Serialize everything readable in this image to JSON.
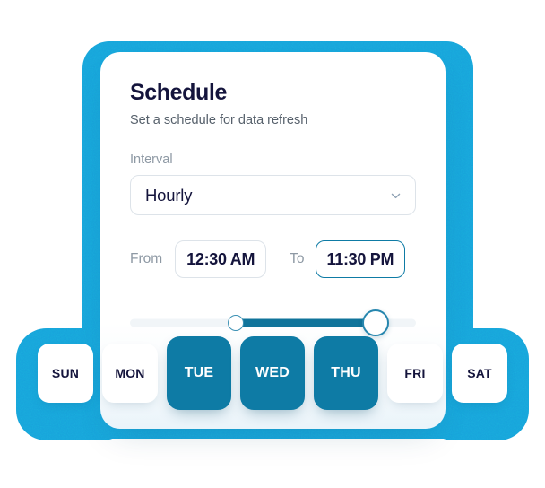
{
  "card": {
    "title": "Schedule",
    "subtitle": "Set a schedule for data refresh"
  },
  "interval": {
    "label": "Interval",
    "value": "Hourly",
    "chevron_icon": "chevron-down-icon"
  },
  "time_range": {
    "from_label": "From",
    "from_value": "12:30 AM",
    "to_label": "To",
    "to_value": "11:30 PM"
  },
  "slider": {
    "low_percent": 37,
    "high_percent": 86
  },
  "days": [
    {
      "label": "SUN",
      "selected": false
    },
    {
      "label": "MON",
      "selected": false
    },
    {
      "label": "TUE",
      "selected": true
    },
    {
      "label": "WED",
      "selected": true
    },
    {
      "label": "THU",
      "selected": true
    },
    {
      "label": "FRI",
      "selected": false
    },
    {
      "label": "SAT",
      "selected": false
    }
  ],
  "colors": {
    "accent": "#0E7BA5",
    "halo": "#17A3DA",
    "track_fill": "#10749B",
    "track_empty": "#F1F5F8",
    "heading": "#14143C",
    "muted": "#8E99A4",
    "border": "#DDE3E9",
    "card": "#FFFFFF"
  }
}
